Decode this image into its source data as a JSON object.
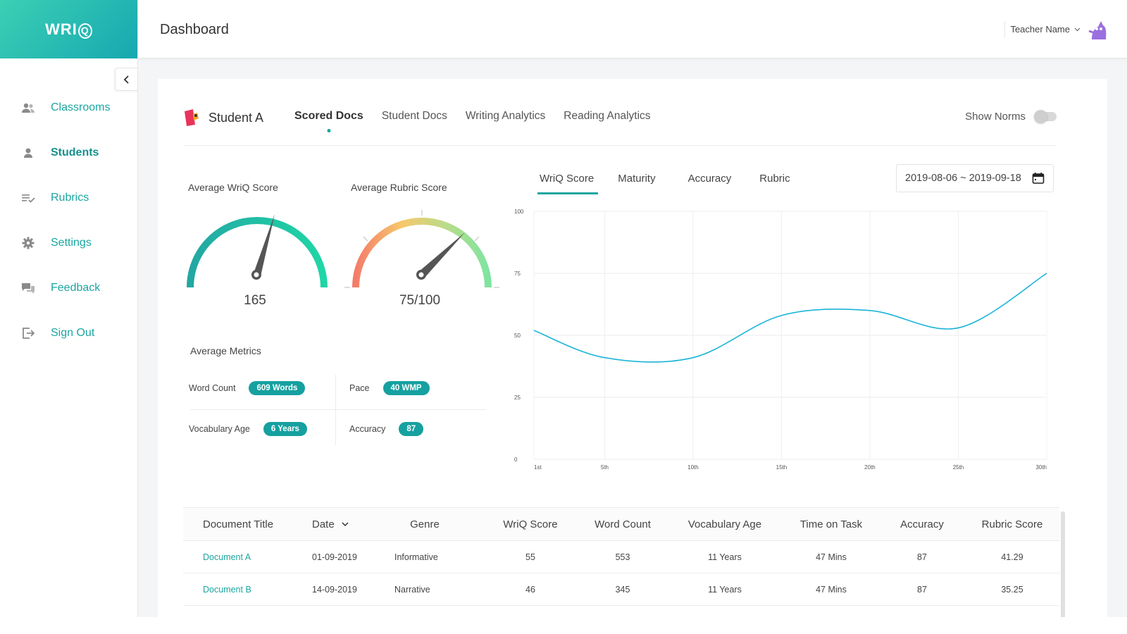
{
  "app": {
    "logo_text": "WRI",
    "logo_q": "Q"
  },
  "header": {
    "title": "Dashboard",
    "user_name": "Teacher Name"
  },
  "sidebar": {
    "items": [
      {
        "label": "Classrooms",
        "icon": "users-icon"
      },
      {
        "label": "Students",
        "icon": "user-icon",
        "active": true
      },
      {
        "label": "Rubrics",
        "icon": "list-check-icon"
      },
      {
        "label": "Settings",
        "icon": "gear-icon"
      },
      {
        "label": "Feedback",
        "icon": "chat-icon"
      },
      {
        "label": "Sign Out",
        "icon": "sign-out-icon"
      }
    ]
  },
  "student": {
    "name": "Student A"
  },
  "tabs": [
    {
      "label": "Scored Docs",
      "active": true
    },
    {
      "label": "Student Docs"
    },
    {
      "label": "Writing Analytics"
    },
    {
      "label": "Reading Analytics"
    }
  ],
  "norms": {
    "label": "Show Norms",
    "enabled": false
  },
  "gauges": {
    "wriq": {
      "label": "Average WriQ Score",
      "value": "165"
    },
    "rubric": {
      "label": "Average Rubric Score",
      "value": "75/100"
    }
  },
  "metrics": {
    "title": "Average Metrics",
    "word_count": {
      "label": "Word Count",
      "value": "609 Words"
    },
    "pace": {
      "label": "Pace",
      "value": "40 WMP"
    },
    "vocab_age": {
      "label": "Vocabulary Age",
      "value": "6 Years"
    },
    "accuracy": {
      "label": "Accuracy",
      "value": "87"
    }
  },
  "chart_tabs": [
    {
      "label": "WriQ Score",
      "active": true
    },
    {
      "label": "Maturity"
    },
    {
      "label": "Accuracy"
    },
    {
      "label": "Rubric"
    }
  ],
  "date_range": "2019-08-06 ~ 2019-09-18",
  "chart_data": {
    "type": "line",
    "x": [
      1,
      5,
      10,
      15,
      20,
      25,
      30
    ],
    "xticks": [
      "1st",
      "5th",
      "10th",
      "15th",
      "20th",
      "25th",
      "30th"
    ],
    "yticks": [
      "100",
      "75",
      "50",
      "25",
      "0"
    ],
    "ylim": [
      0,
      100
    ],
    "xlim": [
      1,
      30
    ],
    "series": [
      {
        "values": [
          52,
          41,
          41,
          58,
          60,
          53,
          75
        ]
      }
    ],
    "line_color": "#1ab4d8",
    "grid": true
  },
  "table": {
    "headers": [
      "Document Title",
      "Date",
      "Genre",
      "WriQ Score",
      "Word Count",
      "Vocabulary Age",
      "Time on Task",
      "Accuracy",
      "Rubric Score"
    ],
    "rows": [
      [
        "Document A",
        "01-09-2019",
        "Informative",
        "55",
        "553",
        "11 Years",
        "47 Mins",
        "87",
        "41.29"
      ],
      [
        "Document B",
        "14-09-2019",
        "Narrative",
        "46",
        "345",
        "11 Years",
        "47 Mins",
        "87",
        "35.25"
      ]
    ]
  },
  "colors": {
    "accent": "#1aa6a0",
    "brand_gradient_start": "#3ccfb4",
    "brand_gradient_end": "#16a8b0"
  }
}
